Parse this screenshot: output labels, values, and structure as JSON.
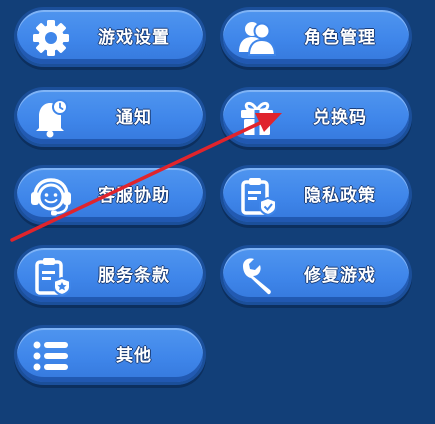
{
  "menu": {
    "game_settings": "游戏设置",
    "role_management": "角色管理",
    "notice": "通知",
    "redeem_code": "兑换码",
    "customer_service": "客服协助",
    "privacy_policy": "隐私政策",
    "terms": "服务条款",
    "repair_game": "修复游戏",
    "other": "其他"
  },
  "icons": {
    "game_settings": "gear-icon",
    "role_management": "users-icon",
    "notice": "bell-icon",
    "redeem_code": "gift-icon",
    "customer_service": "headset-icon",
    "privacy_policy": "clipboard-shield-icon",
    "terms": "clipboard-shield-icon",
    "repair_game": "wrench-icon",
    "other": "list-icon"
  },
  "colors": {
    "background": "#123f78",
    "button": "#4a8fee",
    "annotation_arrow": "#e0242c"
  }
}
